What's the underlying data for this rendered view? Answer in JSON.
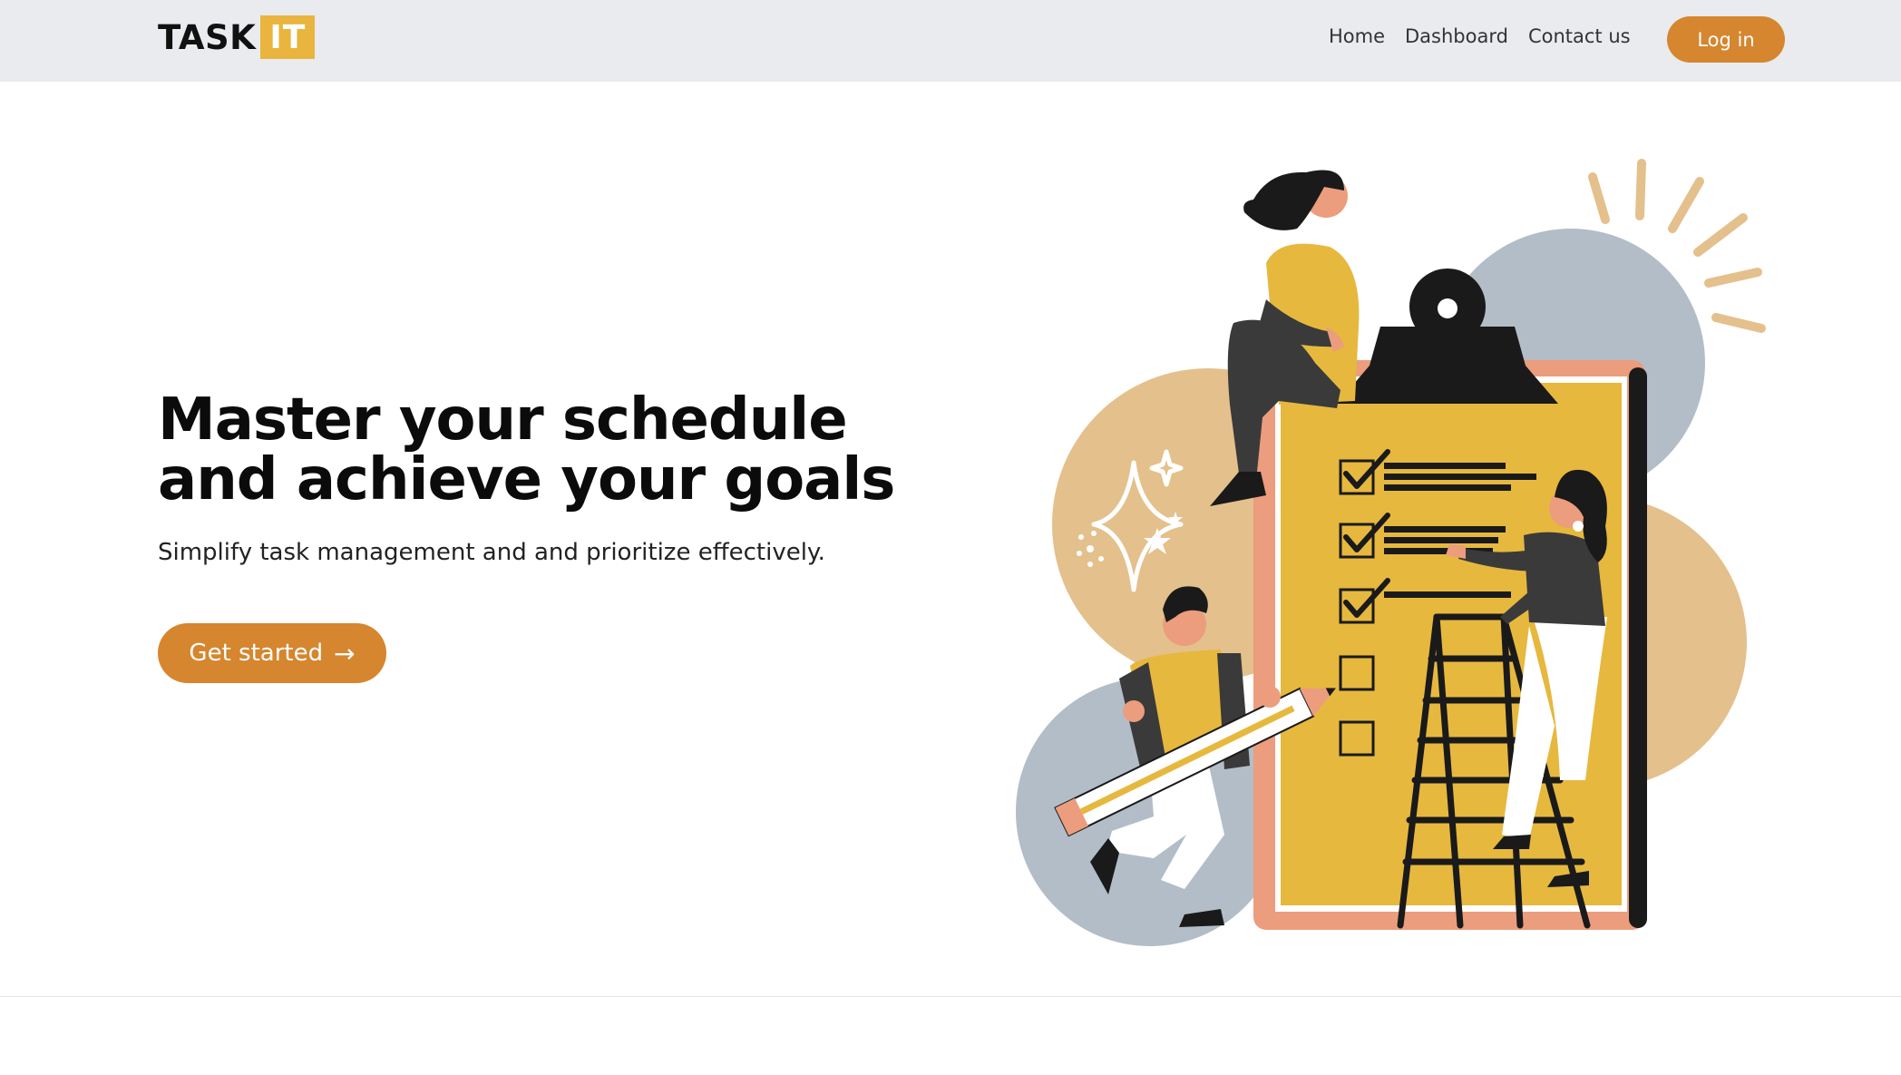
{
  "brand": {
    "part1": "TASK",
    "part2": "IT"
  },
  "nav": {
    "links": [
      "Home",
      "Dashboard",
      "Contact us"
    ],
    "login_label": "Log in"
  },
  "hero": {
    "title_line1": "Master your schedule",
    "title_line2": "and achieve your goals",
    "subtitle": "Simplify task management and and prioritize effectively.",
    "cta_label": "Get started",
    "cta_icon": "arrow-right-icon"
  },
  "colors": {
    "accent": "#d5862f",
    "logo_yellow": "#e9b53e",
    "navbar_bg": "#e9ebee",
    "clipboard_yellow": "#e6b83e",
    "blob_tan": "#e4c08c",
    "blob_gray": "#b3bdc7"
  },
  "illustration": {
    "subject": "people checking off a task checklist on a giant clipboard",
    "checklist": {
      "checked": 3,
      "unchecked": 2
    }
  }
}
